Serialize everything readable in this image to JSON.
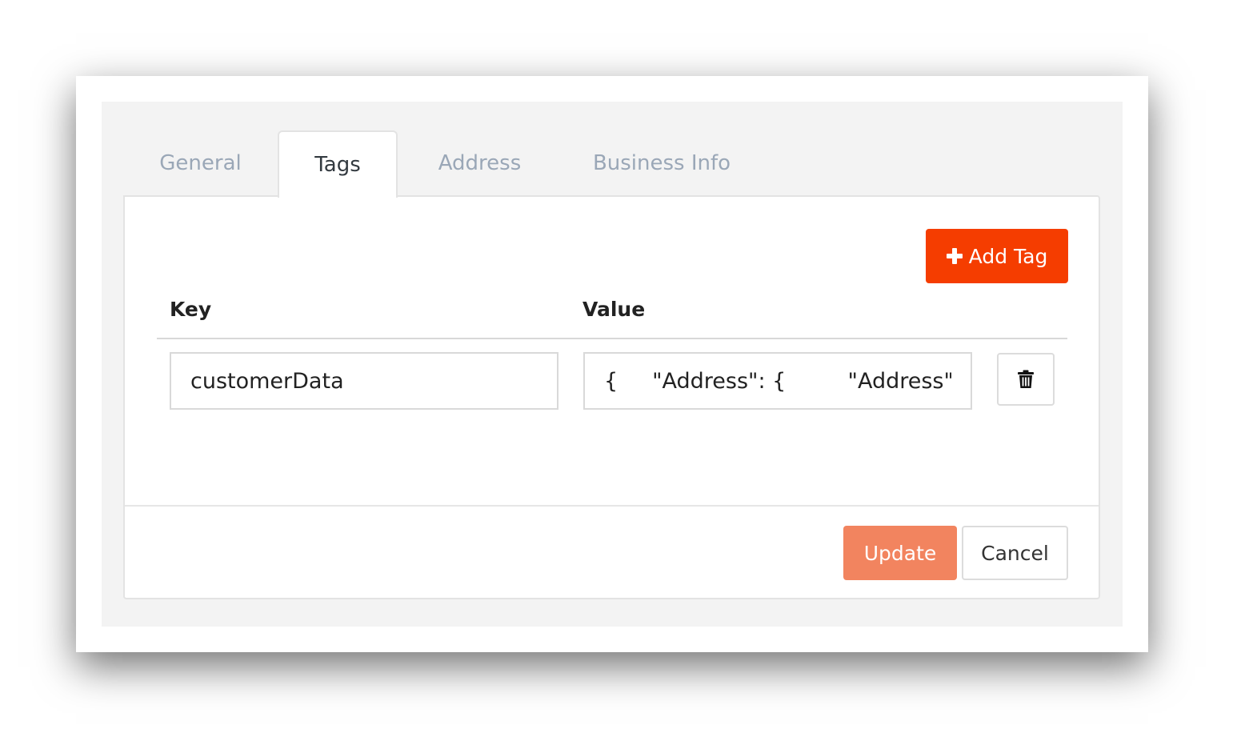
{
  "tabs": [
    {
      "label": "General",
      "active": false
    },
    {
      "label": "Tags",
      "active": true
    },
    {
      "label": "Address",
      "active": false
    },
    {
      "label": "Business Info",
      "active": false
    }
  ],
  "toolbar": {
    "add_tag_label": "Add Tag",
    "add_tag_icon": "plus-icon"
  },
  "table": {
    "columns": [
      "Key",
      "Value"
    ],
    "rows": [
      {
        "key": "customerData",
        "value": "{     \"Address\": {         \"Address\": \"",
        "delete_icon": "trash-icon"
      }
    ]
  },
  "footer": {
    "update_label": "Update",
    "cancel_label": "Cancel"
  },
  "colors": {
    "accent": "#f53d00",
    "update": "#f2845f",
    "tab_inactive": "#9aa7b7",
    "tab_active": "#333a40"
  }
}
